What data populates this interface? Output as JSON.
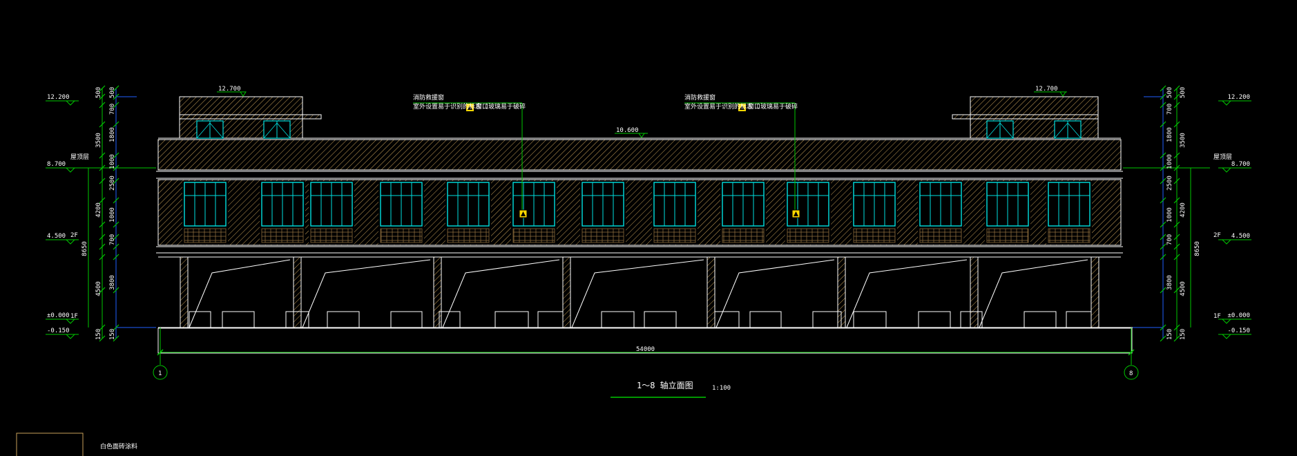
{
  "colors": {
    "background": "#000000",
    "wall_outline": "#ffffff",
    "hatch": "#c9a15a",
    "window_frame": "#00e0e0",
    "dimension": "#00c800",
    "axis": "#00c800",
    "leader": "#00c800",
    "marker": "#ffd800",
    "dim_blue": "#2060ff"
  },
  "icons": {
    "axis_bubble": "circle-icon",
    "warning_marker": "warning-square-icon",
    "elevation_mark": "triangle-down-icon"
  },
  "title": {
    "text": "1～8 轴立面图",
    "scale": "1:100"
  },
  "legend": {
    "label": "白色面砖涂料"
  },
  "annotations": {
    "left": {
      "title": "消防救援窗",
      "line": "室外设置易于识别的标志（",
      "line_end": "窗口玻璃易于破碎"
    },
    "right": {
      "title": "消防救援窗",
      "line": "室外设置易于识别的标志（",
      "line_end": "窗口玻璃易于破碎"
    }
  },
  "elevations": {
    "roof_left": "12.700",
    "roof_right": "12.700",
    "parapet": "10.600",
    "left": [
      "12.200",
      "8.700",
      "4.500",
      "±0.000",
      "-0.150"
    ],
    "right": [
      "12.200",
      "8.700",
      "4.500",
      "±0.000",
      "-0.150"
    ],
    "floor_labels_left": [
      "屋顶层",
      "2F",
      "1F"
    ],
    "floor_labels_right": [
      "屋顶层",
      "2F",
      "1F"
    ]
  },
  "dimensions": {
    "left_outer": [
      "500",
      "3500",
      "4200",
      "4500",
      "150"
    ],
    "left_inner": [
      "500",
      "700",
      "1800",
      "1000",
      "2500",
      "1000",
      "700",
      "3800",
      "150"
    ],
    "left_total": "8650",
    "right_outer": [
      "500",
      "3500",
      "4200",
      "4500",
      "150"
    ],
    "right_inner": [
      "500",
      "700",
      "1800",
      "1000",
      "2500",
      "1000",
      "700",
      "3800",
      "150"
    ],
    "right_total": "8650",
    "overall_width": "54000"
  },
  "axes": {
    "start": "1",
    "end": "8"
  }
}
